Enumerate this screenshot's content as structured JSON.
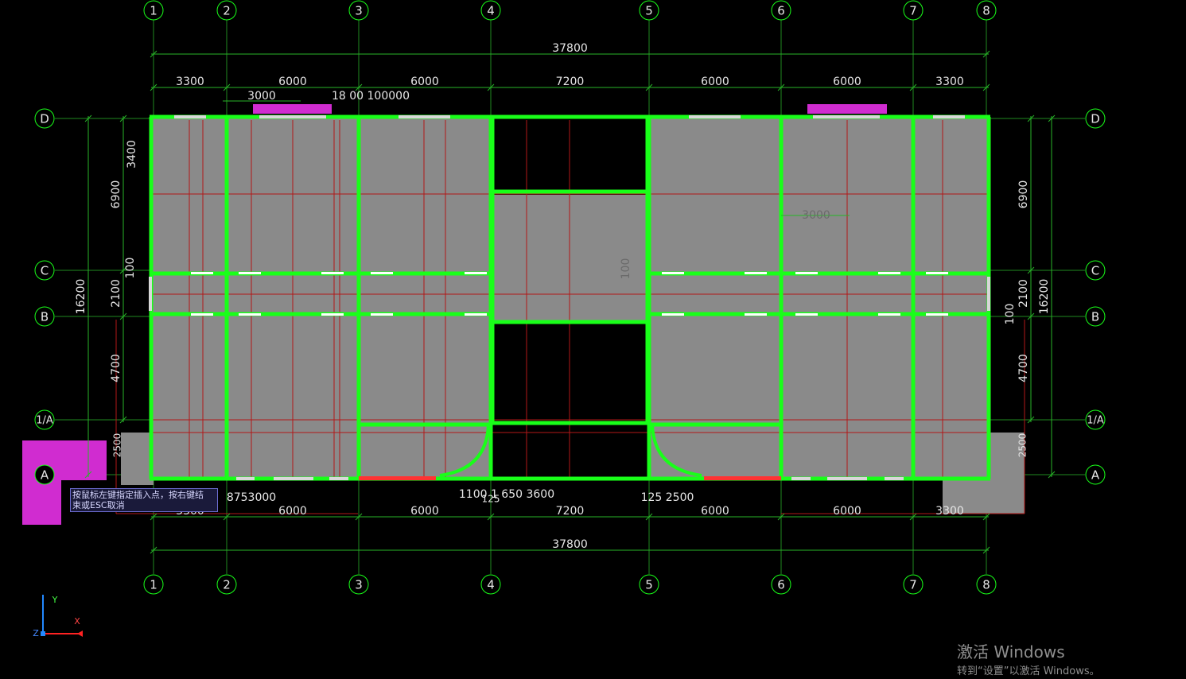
{
  "colors": {
    "background": "#000000",
    "axis_line": "#1f8a1f",
    "dim_line": "#27b527",
    "dim_text": "#e6e6e6",
    "wall": "#19ff19",
    "slab": "#8a8a8a",
    "beam": "#b21818",
    "window": "#d8d8d8",
    "magenta": "#d02cd0",
    "red_bar": "#ff3333",
    "ucs_x": "#ff2222",
    "ucs_y": "#2288ff"
  },
  "axes": {
    "vertical_labels": [
      "1",
      "2",
      "3",
      "4",
      "5",
      "6",
      "7",
      "8"
    ],
    "horizontal_labels": [
      "D",
      "C",
      "B",
      "1/A",
      "A"
    ]
  },
  "dims": {
    "overall": "37800",
    "top_spans": [
      "3300",
      "6000",
      "6000",
      "7200",
      "6000",
      "6000",
      "3300"
    ],
    "top_extra_1": "3000",
    "top_extra_2": "18 00 100000",
    "bottom_spans": [
      "3300",
      "6000",
      "6000",
      "7200",
      "6000",
      "6000",
      "3300"
    ],
    "bottom_extra_1": "8753000",
    "bottom_extra_2": "1100 1 650 3600",
    "bottom_extra_3": "125",
    "bottom_extra_4": "125 2500",
    "left_total": "16200",
    "left_parts": [
      "6900",
      "2100",
      "4700"
    ],
    "left_small_1": "3400",
    "left_small_2": "100",
    "left_small_3": "2500",
    "right_total": "16200",
    "right_parts": [
      "6900",
      "2100",
      "4700"
    ],
    "right_small_1": "100",
    "right_small_2": "2500",
    "inner_1": "3000",
    "inner_2": "100"
  },
  "tooltip": {
    "line1": "按鼠标左键指定插入点，按右键结",
    "line2": "束或ESC取消"
  },
  "ucs": {
    "x": "X",
    "y": "Y",
    "z": "Z"
  },
  "watermark": {
    "title": "激活 Windows",
    "subtitle": "转到“设置”以激活 Windows。"
  }
}
